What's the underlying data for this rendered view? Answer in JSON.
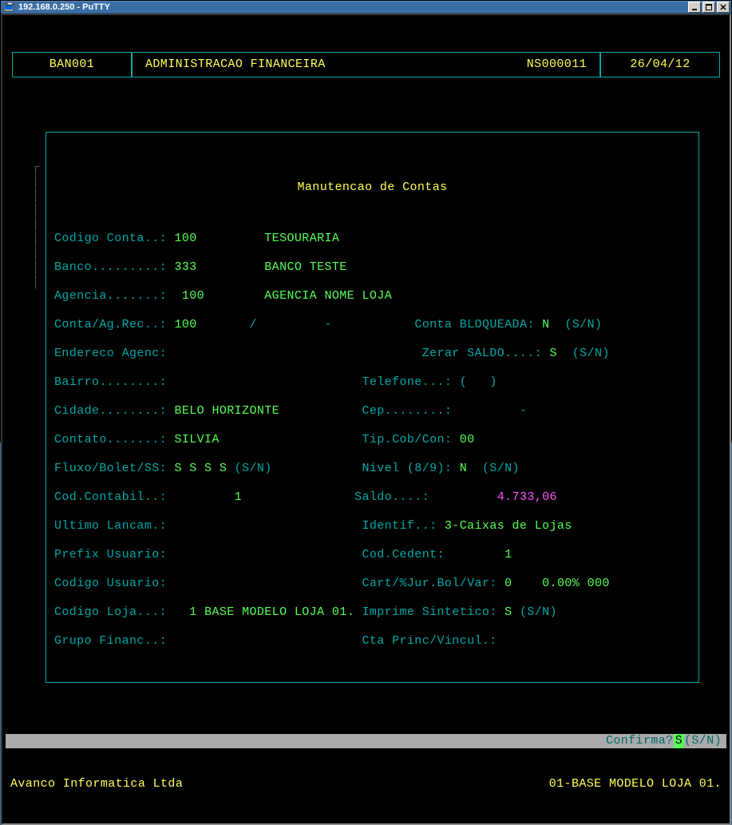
{
  "window": {
    "title": "192.168.0.250 - PuTTY"
  },
  "header": {
    "code": "BAN001",
    "title": "ADMINISTRACAO FINANCEIRA",
    "ns": "NS000011",
    "date": "26/04/12"
  },
  "panel": {
    "title": "Manutencao de Contas",
    "codigo_conta_lbl": "Codigo Conta..:",
    "codigo_conta": "100",
    "codigo_conta_desc": "TESOURARIA",
    "banco_lbl": "Banco.........:",
    "banco": "333",
    "banco_desc": "BANCO TESTE",
    "agencia_lbl": "Agencia.......:",
    "agencia": " 100",
    "agencia_desc": "AGENCIA NOME LOJA",
    "conta_ag_lbl": "Conta/Ag.Rec..:",
    "conta_ag_val": "100",
    "conta_ag_sep": "/",
    "conta_ag_dash": "-",
    "conta_bloq_lbl": "Conta BLOQUEADA:",
    "conta_bloq": "N",
    "sn": "(S/N)",
    "endereco_lbl": "Endereco Agenc:",
    "zerar_lbl": "Zerar SALDO....:",
    "zerar": "S",
    "bairro_lbl": "Bairro........:",
    "telefone_lbl": "Telefone...:",
    "telefone": "(   )",
    "cidade_lbl": "Cidade........:",
    "cidade": "BELO HORIZONTE",
    "cep_lbl": "Cep........:",
    "cep_dash": "-",
    "contato_lbl": "Contato.......:",
    "contato": "SILVIA",
    "tipcob_lbl": "Tip.Cob/Con:",
    "tipcob": "00",
    "fluxo_lbl": "Fluxo/Bolet/SS:",
    "fluxo": "S S S S",
    "nivel_lbl": "Nivel (8/9):",
    "nivel": "N",
    "codcontabil_lbl": "Cod.Contabil..:",
    "codcontabil": "1",
    "saldo_lbl": "Saldo....:",
    "saldo": "4.733,06",
    "ultimo_lbl": "Ultimo Lancam.:",
    "identif_lbl": "Identif..:",
    "identif": "3-Caixas de Lojas",
    "prefix_lbl": "Prefix Usuario:",
    "codcedent_lbl": "Cod.Cedent:",
    "codcedent": "1",
    "codusr_lbl": "Codigo Usuario:",
    "cart_lbl": "Cart/%Jur.Bol/Var:",
    "cart_v1": "0",
    "cart_v2": "0.00%",
    "cart_v3": "000",
    "codloja_lbl": "Codigo Loja...:",
    "codloja": "1",
    "codloja_desc": "BASE MODELO LOJA 01.",
    "imprime_lbl": "Imprime Sintetico:",
    "imprime": "S",
    "grupo_lbl": "Grupo Financ..:",
    "ctaprinc_lbl": "Cta Princ/Vincul.:"
  },
  "status": {
    "confirm_lbl": "Confirma?",
    "confirm_val": "S",
    "sn": "(S/N)",
    "company": "Avanco Informatica Ltda",
    "base": "01-BASE MODELO LOJA 01."
  }
}
